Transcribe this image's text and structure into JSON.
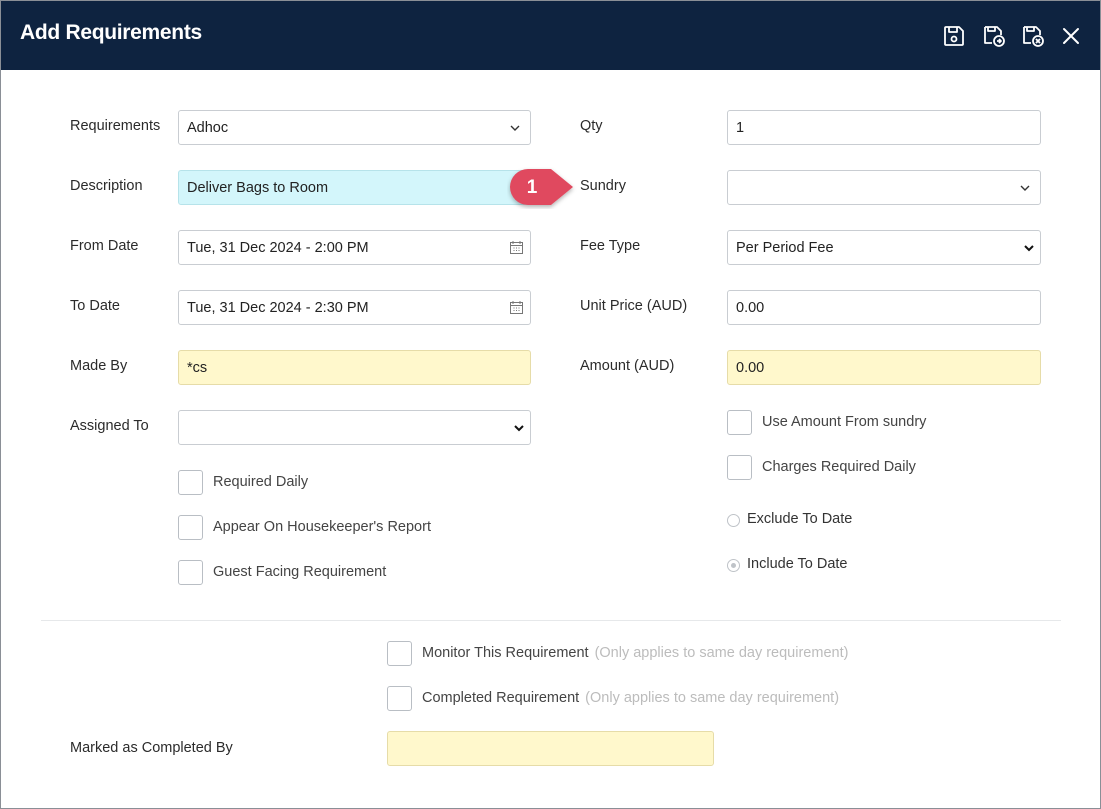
{
  "window": {
    "title": "Add Requirements",
    "toolbar": {
      "save_icon": "save-icon",
      "save_and_new_icon": "save-and-new-icon",
      "save_and_close_icon": "save-and-close-icon",
      "close_icon": "close-icon"
    }
  },
  "form": {
    "requirements": {
      "label": "Requirements",
      "value": "Adhoc"
    },
    "description": {
      "label": "Description",
      "value": "Deliver Bags to Room"
    },
    "from_date": {
      "label": "From Date",
      "value": "Tue, 31 Dec 2024 - 2:00 PM"
    },
    "to_date": {
      "label": "To Date",
      "value": "Tue, 31 Dec 2024 - 2:30 PM"
    },
    "made_by": {
      "label": "Made By",
      "value": "*cs"
    },
    "assigned_to": {
      "label": "Assigned To",
      "value": ""
    },
    "qty": {
      "label": "Qty",
      "value": "1"
    },
    "sundry": {
      "label": "Sundry",
      "value": ""
    },
    "fee_type": {
      "label": "Fee Type",
      "value": "Per Period Fee"
    },
    "unit_price": {
      "label": "Unit Price (AUD)",
      "value": "0.00"
    },
    "amount": {
      "label": "Amount (AUD)",
      "value": "0.00"
    },
    "checkboxes": {
      "required_daily": "Required Daily",
      "appear_housekeeper": "Appear On Housekeeper's Report",
      "guest_facing": "Guest Facing Requirement",
      "use_amount_sundry": "Use Amount From sundry",
      "charges_required_daily": "Charges Required Daily"
    },
    "radios": {
      "exclude_to_date": "Exclude To Date",
      "include_to_date": "Include To Date",
      "selected": "include_to_date"
    },
    "monitor": {
      "monitor_label": "Monitor This Requirement",
      "monitor_hint": "(Only applies to same day requirement)",
      "completed_label": "Completed Requirement",
      "completed_hint": "(Only applies to same day requirement)",
      "marked_completed_by_label": "Marked as Completed By",
      "marked_completed_by_value": ""
    }
  },
  "annotation": {
    "step_number": "1"
  },
  "colors": {
    "titlebar": "#0e2340",
    "description_bg": "#d3f6fb",
    "readonly_bg": "#fff8cc",
    "marker": "#e0495e"
  }
}
